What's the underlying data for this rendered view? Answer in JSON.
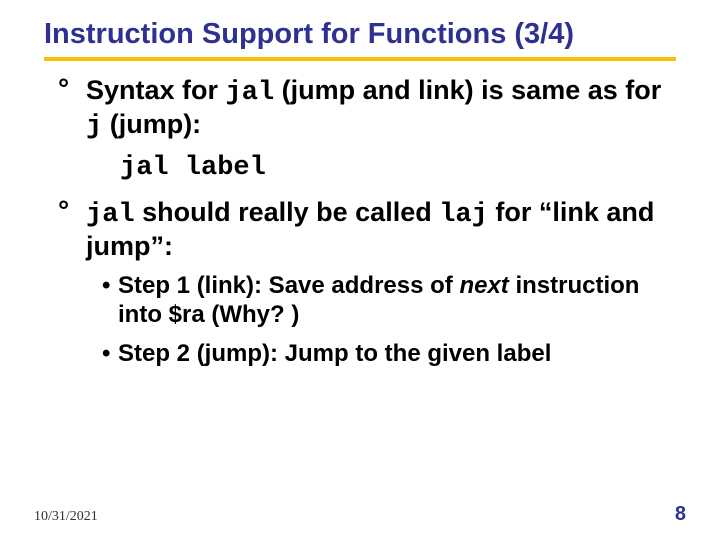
{
  "title": "Instruction Support for Functions (3/4)",
  "b1": {
    "pre": "Syntax for ",
    "code1": "jal",
    "mid": " (jump and link) is same as for ",
    "code2": "j",
    "post": " (jump):"
  },
  "codeLine": "jal label",
  "b2": {
    "code1": "jal",
    "mid1": " should really be called ",
    "code2": "laj",
    "mid2": " for “link and jump”:"
  },
  "s1": {
    "dot": "•",
    "lead": "Step 1 (link): Save address of ",
    "em": "next",
    "tail": " instruction into $ra (Why? )"
  },
  "s2": {
    "dot": "•",
    "text": "Step 2 (jump): Jump to the given label"
  },
  "footer": {
    "date": "10/31/2021",
    "page": "8"
  }
}
